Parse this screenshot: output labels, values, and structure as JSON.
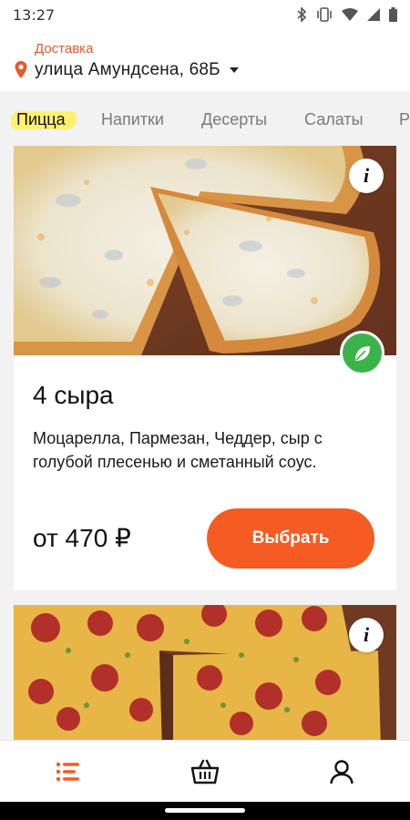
{
  "status_bar": {
    "time": "13:27",
    "icons": [
      "bluetooth-icon",
      "vibrate-icon",
      "wifi-icon",
      "signal-icon",
      "battery-icon"
    ]
  },
  "header": {
    "delivery_label": "Доставка",
    "address": "улица Амундсена, 68Б"
  },
  "tabs": [
    {
      "label": "Пицца",
      "active": true
    },
    {
      "label": "Напитки",
      "active": false
    },
    {
      "label": "Десерты",
      "active": false
    },
    {
      "label": "Салаты",
      "active": false
    },
    {
      "label": "Р",
      "active": false
    }
  ],
  "products": [
    {
      "name": "4 сыра",
      "description": "Моцарелла, Пармезан, Чеддер, сыр с голубой плесенью и сметанный соус.",
      "price": "от 470 ₽",
      "select_label": "Выбрать",
      "info_symbol": "i",
      "vegetarian": true
    },
    {
      "info_symbol": "i"
    }
  ],
  "bottom_nav": [
    "menu-icon",
    "basket-icon",
    "profile-icon"
  ],
  "colors": {
    "accent": "#f55b22",
    "delivery_label": "#e8582a",
    "tab_highlight": "#fff170",
    "veg_badge": "#3bb34a"
  }
}
